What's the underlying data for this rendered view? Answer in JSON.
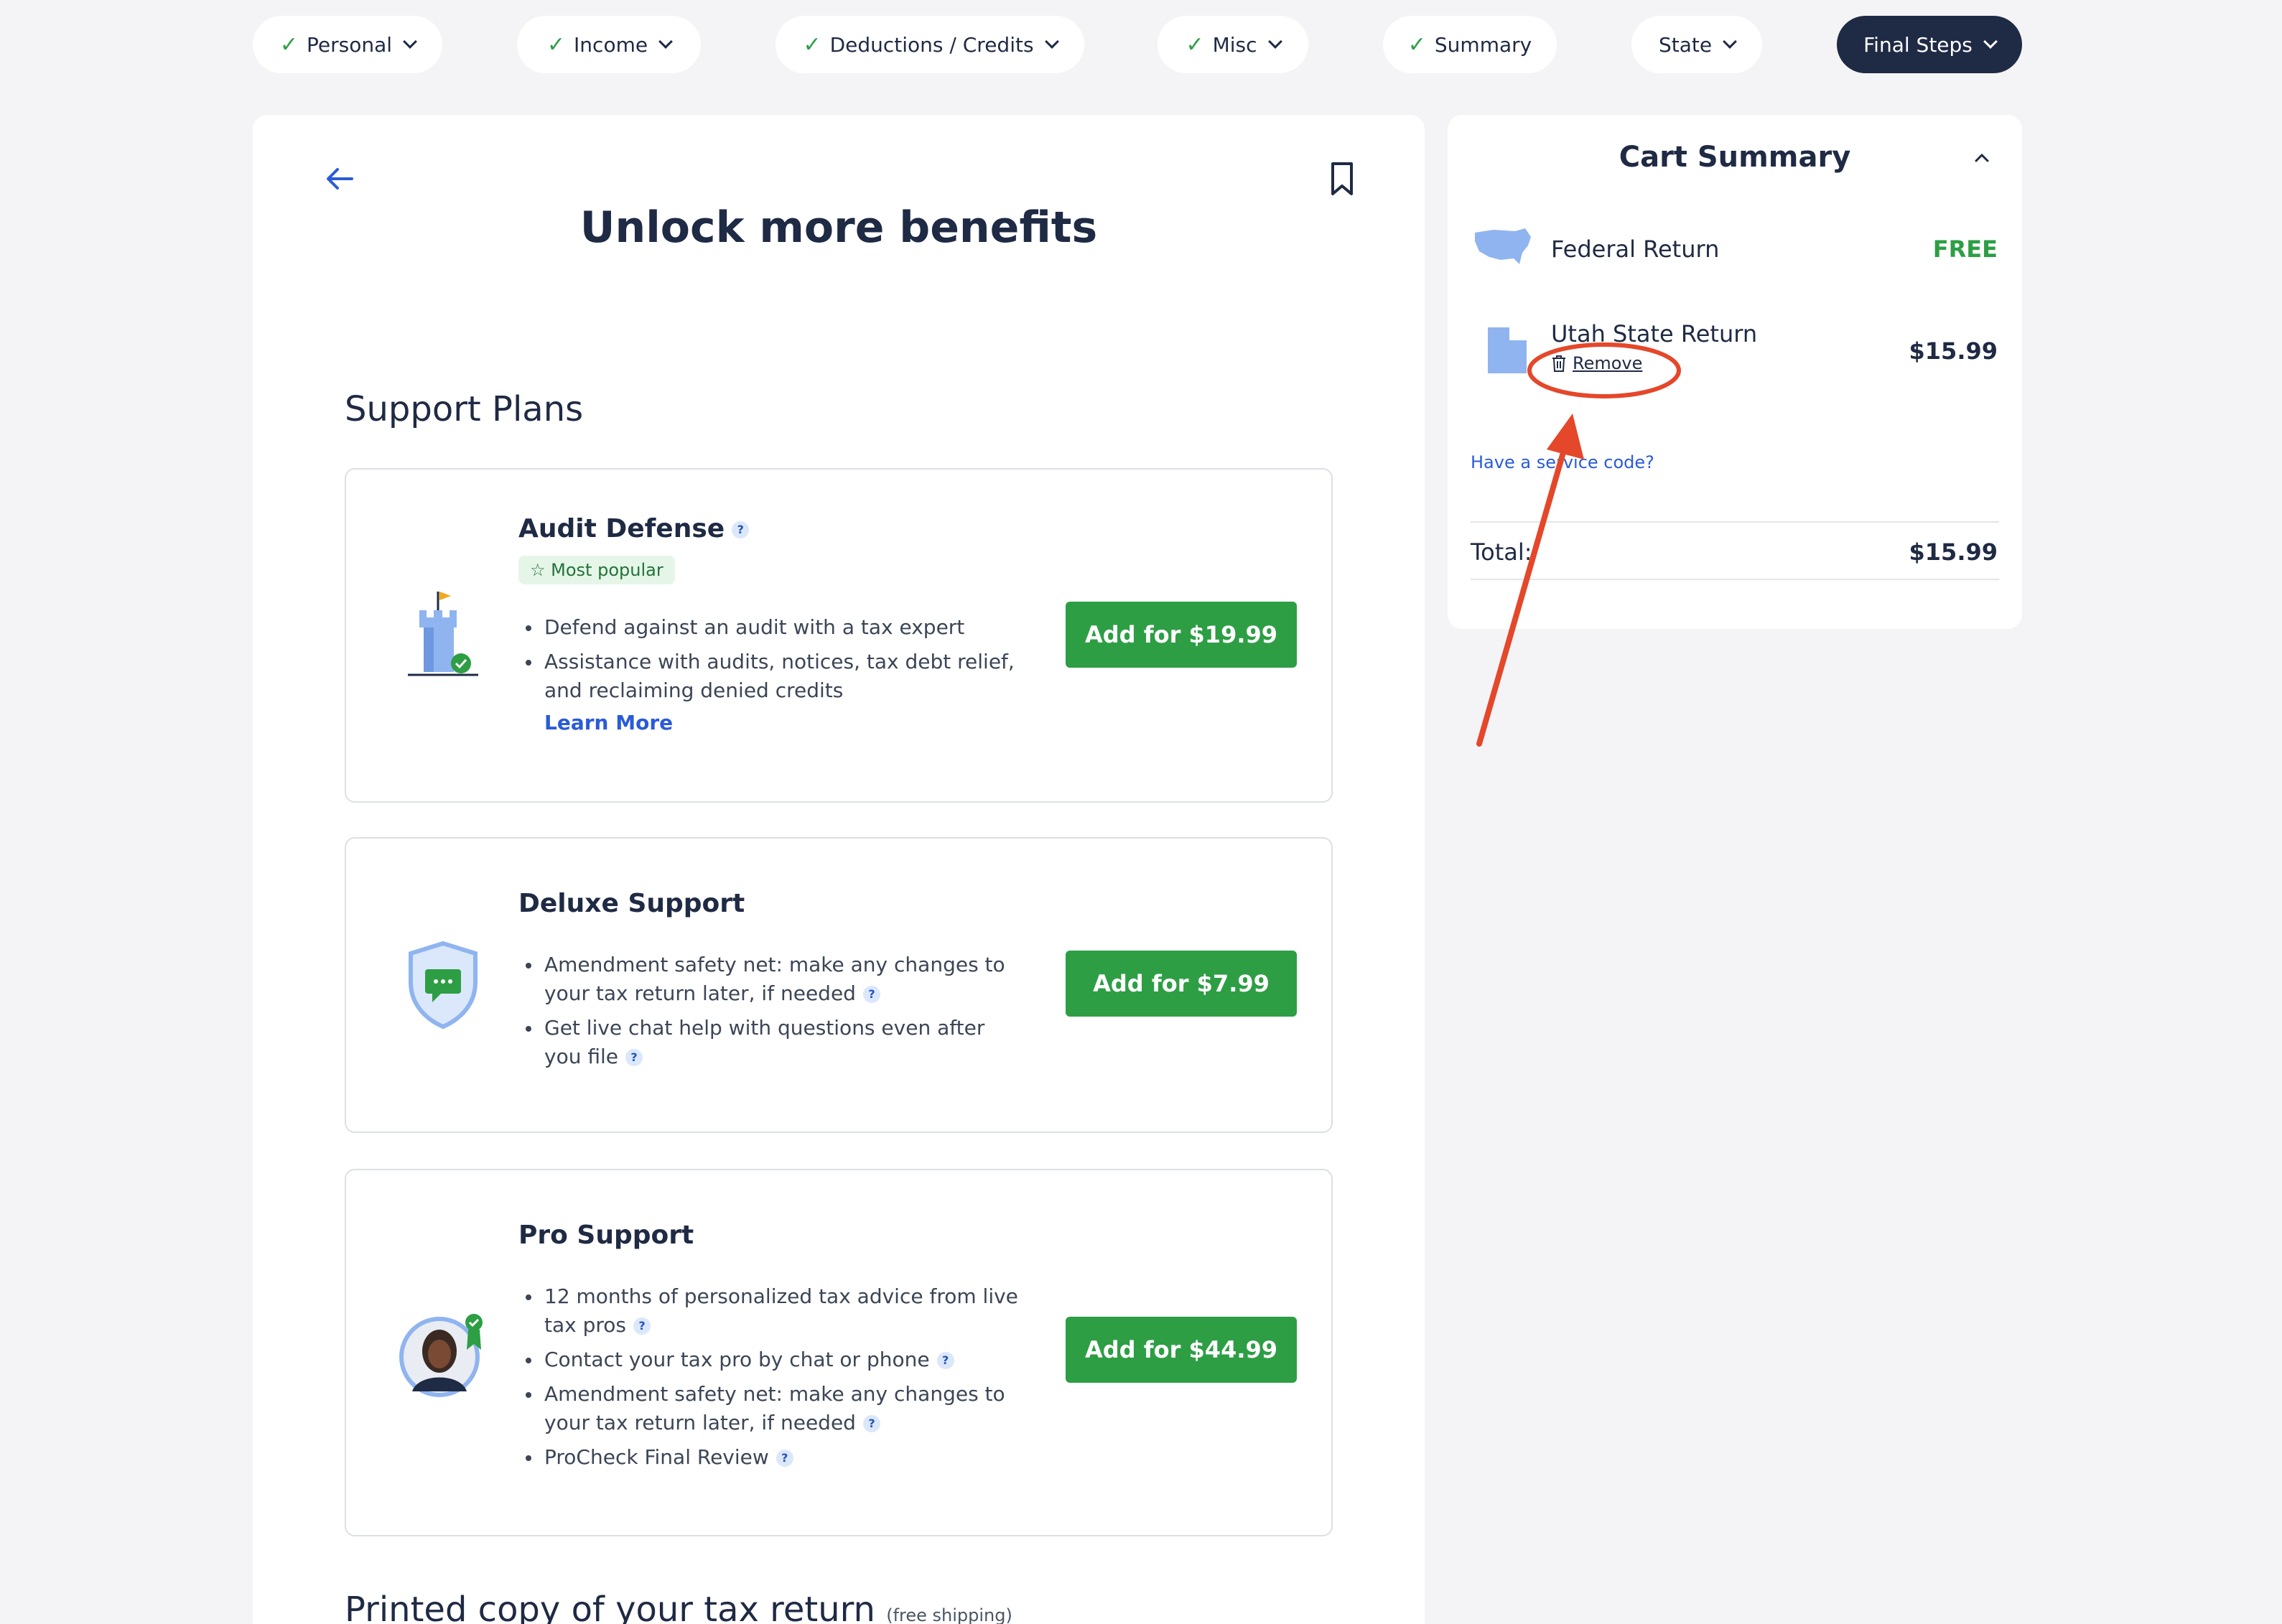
{
  "nav": {
    "steps": [
      {
        "label": "Personal",
        "done": true
      },
      {
        "label": "Income",
        "done": true
      },
      {
        "label": "Deductions / Credits",
        "done": true
      },
      {
        "label": "Misc",
        "done": true
      },
      {
        "label": "Summary",
        "done": true
      },
      {
        "label": "State",
        "done": false
      },
      {
        "label": "Final Steps",
        "done": false,
        "active": true
      }
    ]
  },
  "main": {
    "title": "Unlock more benefits",
    "section_title": "Support Plans",
    "plans": [
      {
        "name": "Audit Defense",
        "badge": "Most popular",
        "bullets": [
          "Defend against an audit with a tax expert",
          "Assistance with audits, notices, tax debt relief, and reclaiming denied credits"
        ],
        "learn_more": "Learn More",
        "button": "Add for $19.99"
      },
      {
        "name": "Deluxe Support",
        "bullets": [
          "Amendment safety net: make any changes to your tax return later, if needed",
          "Get live chat help with questions even after you file"
        ],
        "button": "Add for $7.99"
      },
      {
        "name": "Pro Support",
        "bullets": [
          "12 months of personalized tax advice from live tax pros",
          "Contact your tax pro by chat or phone",
          "Amendment safety net: make any changes to your tax return later, if needed",
          "ProCheck Final Review"
        ],
        "button": "Add for $44.99"
      }
    ],
    "printed_title": "Printed copy of your tax return",
    "printed_sub": "(free shipping)"
  },
  "cart": {
    "title": "Cart Summary",
    "items": [
      {
        "label": "Federal Return",
        "price": "FREE"
      },
      {
        "label": "Utah State Return",
        "price": "$15.99",
        "remove": "Remove"
      }
    ],
    "service_code": "Have a service code?",
    "total_label": "Total:",
    "total_value": "$15.99"
  },
  "colors": {
    "accent_green": "#2d9e44",
    "navy": "#1f2a44",
    "link_blue": "#2a5bd7",
    "annotation_red": "#e5472a"
  }
}
